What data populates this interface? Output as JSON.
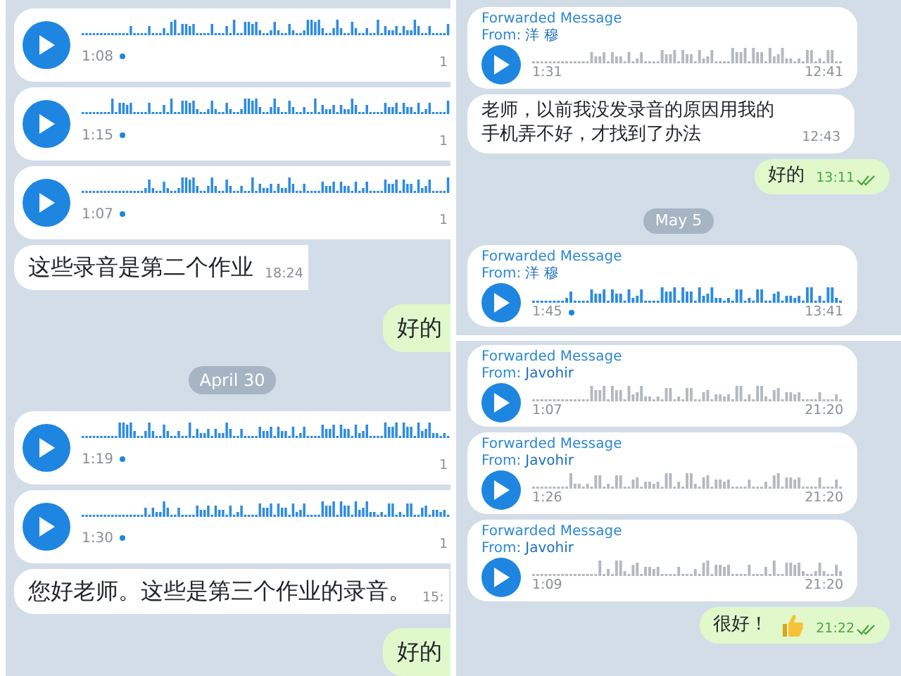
{
  "panels": [
    {
      "messages": [
        {
          "kind": "voice",
          "outgoing": false,
          "duration": "1:08",
          "listened": false,
          "time": "1"
        },
        {
          "kind": "voice",
          "outgoing": false,
          "duration": "1:15",
          "listened": false,
          "time": "1"
        },
        {
          "kind": "voice",
          "outgoing": false,
          "duration": "1:07",
          "listened": false,
          "time": "1"
        },
        {
          "kind": "text",
          "outgoing": false,
          "text": "这些录音是第二个作业",
          "time": "18:24"
        },
        {
          "kind": "text",
          "outgoing": true,
          "text": "好的"
        },
        {
          "kind": "date",
          "text": "April 30"
        },
        {
          "kind": "voice",
          "outgoing": false,
          "duration": "1:19",
          "listened": false,
          "time": "1"
        },
        {
          "kind": "voice",
          "outgoing": false,
          "duration": "1:30",
          "listened": false,
          "time": "1"
        },
        {
          "kind": "text",
          "outgoing": false,
          "text": "您好老师。这些是第三个作业的录音。",
          "time": "15:"
        },
        {
          "kind": "text",
          "outgoing": true,
          "text": "好的"
        }
      ]
    },
    {
      "messages": [
        {
          "kind": "voice",
          "outgoing": false,
          "forwarded": "Forwarded Message",
          "from_label": "From:",
          "from": "洋 穆",
          "duration": "1:31",
          "listened": true,
          "time": "12:41"
        },
        {
          "kind": "text",
          "outgoing": false,
          "text": "老师，以前我没发录音的原因用我的手机弄不好，才找到了办法",
          "time": "12:43"
        },
        {
          "kind": "text",
          "outgoing": true,
          "text": "好的",
          "time": "13:11",
          "read": true
        },
        {
          "kind": "date",
          "text": "May 5"
        },
        {
          "kind": "voice",
          "outgoing": false,
          "forwarded": "Forwarded Message",
          "from_label": "From:",
          "from": "洋 穆",
          "duration": "1:45",
          "listened": false,
          "time": "13:41"
        }
      ]
    },
    {
      "messages": [
        {
          "kind": "voice",
          "outgoing": false,
          "forwarded": "Forwarded Message",
          "from_label": "From:",
          "from": "Javohir",
          "duration": "1:07",
          "listened": true,
          "time": "21:20"
        },
        {
          "kind": "voice",
          "outgoing": false,
          "forwarded": "Forwarded Message",
          "from_label": "From:",
          "from": "Javohir",
          "duration": "1:26",
          "listened": true,
          "time": "21:20"
        },
        {
          "kind": "voice",
          "outgoing": false,
          "forwarded": "Forwarded Message",
          "from_label": "From:",
          "from": "Javohir",
          "duration": "1:09",
          "listened": true,
          "time": "21:20"
        },
        {
          "kind": "text",
          "outgoing": true,
          "text": "很好！",
          "emoji": true,
          "time": "21:22",
          "read": true
        }
      ]
    }
  ]
}
